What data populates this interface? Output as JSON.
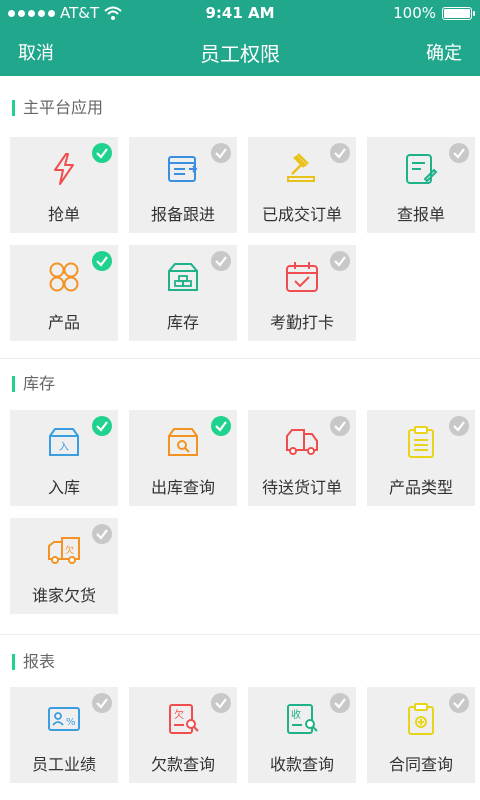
{
  "status": {
    "carrier": "AT&T",
    "time": "9:41 AM",
    "battery": "100%"
  },
  "nav": {
    "left": "取消",
    "title": "员工权限",
    "right": "确定"
  },
  "colors": {
    "brand": "#21a78c",
    "check_on": "#1fd28e",
    "check_off": "#c8c8c8"
  },
  "sections": [
    {
      "title": "主平台应用",
      "tiles": [
        {
          "label": "抢单",
          "icon": "lightning-icon",
          "checked": true
        },
        {
          "label": "报备跟进",
          "icon": "report-icon",
          "checked": false
        },
        {
          "label": "已成交订单",
          "icon": "gavel-icon",
          "checked": false
        },
        {
          "label": "查报单",
          "icon": "document-edit-icon",
          "checked": false
        },
        {
          "label": "产品",
          "icon": "grid-icon",
          "checked": true
        },
        {
          "label": "库存",
          "icon": "warehouse-icon",
          "checked": false
        },
        {
          "label": "考勤打卡",
          "icon": "calendar-check-icon",
          "checked": false
        }
      ]
    },
    {
      "title": "库存",
      "tiles": [
        {
          "label": "入库",
          "icon": "box-in-icon",
          "checked": true
        },
        {
          "label": "出库查询",
          "icon": "box-search-icon",
          "checked": true
        },
        {
          "label": "待送货订单",
          "icon": "truck-icon",
          "checked": false
        },
        {
          "label": "产品类型",
          "icon": "clipboard-icon",
          "checked": false
        },
        {
          "label": "谁家欠货",
          "icon": "truck-owe-icon",
          "checked": false
        }
      ]
    },
    {
      "title": "报表",
      "tiles": [
        {
          "label": "员工业绩",
          "icon": "id-card-icon",
          "checked": false
        },
        {
          "label": "欠款查询",
          "icon": "debt-search-icon",
          "checked": false
        },
        {
          "label": "收款查询",
          "icon": "receipt-search-icon",
          "checked": false
        },
        {
          "label": "合同查询",
          "icon": "contract-icon",
          "checked": false
        }
      ]
    }
  ]
}
